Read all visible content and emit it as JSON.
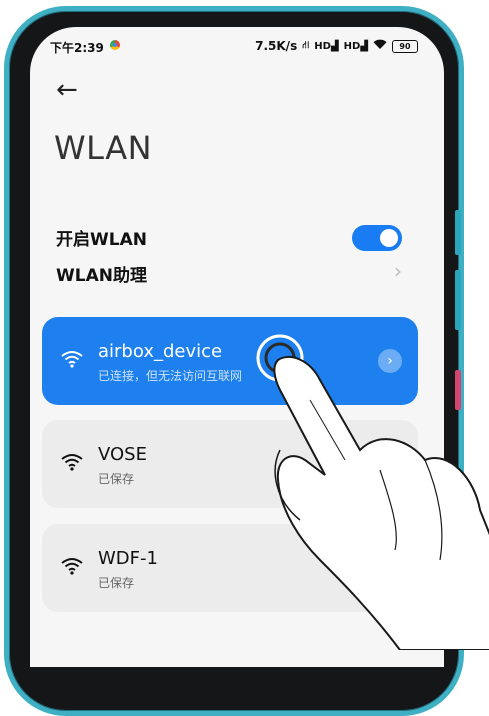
{
  "status_bar": {
    "time": "下午2:39",
    "speed": "7.5K/s",
    "signal1": "HD",
    "signal2": "HD",
    "battery": "90"
  },
  "page": {
    "back_icon": "back-arrow-icon",
    "title": "WLAN"
  },
  "settings": {
    "wlan_toggle_label": "开启WLAN",
    "wlan_toggle_on": true,
    "assistant_label": "WLAN助理"
  },
  "networks": [
    {
      "name": "airbox_device",
      "status": "已连接，但无法访问互联网",
      "active": true
    },
    {
      "name": "VOSE",
      "status": "已保存",
      "active": false
    },
    {
      "name": "WDF-1",
      "status": "已保存",
      "active": false
    }
  ],
  "colors": {
    "accent": "#1d80ee",
    "frame": "#3fb0c4"
  }
}
